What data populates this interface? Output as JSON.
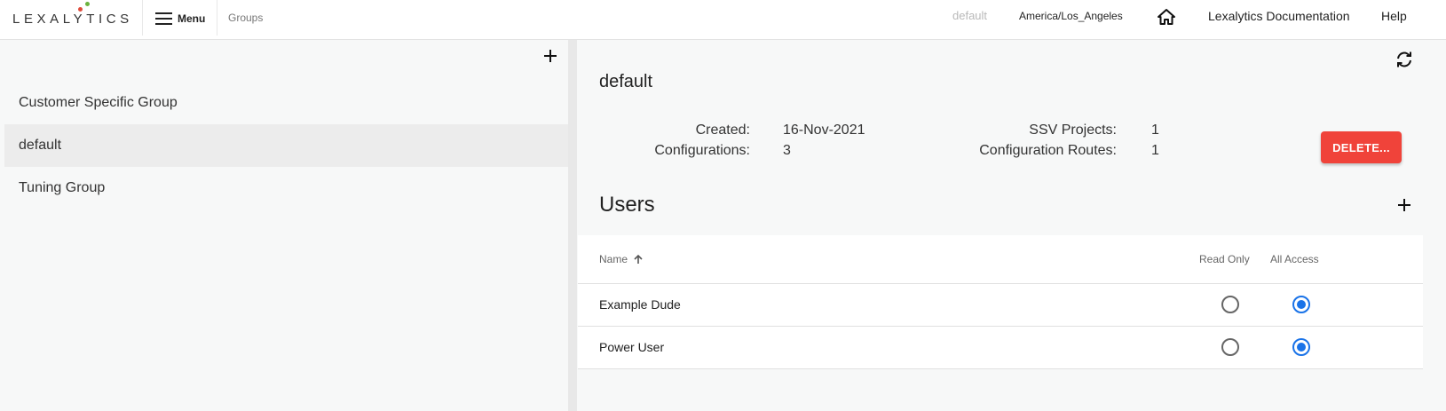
{
  "brand": {
    "logo_text": "LEXALYTICS"
  },
  "topbar": {
    "menu_label": "Menu",
    "breadcrumb": "Groups",
    "current_group": "default",
    "timezone": "America/Los_Angeles",
    "home_icon": "home-icon",
    "docs_link": "Lexalytics Documentation",
    "help_link": "Help"
  },
  "groups": {
    "add_icon": "plus-icon",
    "items": [
      {
        "label": "Customer Specific Group",
        "selected": false
      },
      {
        "label": "default",
        "selected": true
      },
      {
        "label": "Tuning Group",
        "selected": false
      }
    ]
  },
  "detail": {
    "title": "default",
    "refresh_icon": "refresh-icon",
    "stats": {
      "created_label": "Created:",
      "created_value": "16-Nov-2021",
      "configurations_label": "Configurations:",
      "configurations_value": "3",
      "ssv_projects_label": "SSV Projects:",
      "ssv_projects_value": "1",
      "config_routes_label": "Configuration Routes:",
      "config_routes_value": "1"
    },
    "delete_label": "DELETE..."
  },
  "users": {
    "title": "Users",
    "add_icon": "plus-icon",
    "columns": {
      "name": "Name",
      "read_only": "Read Only",
      "all_access": "All Access"
    },
    "sort_icon": "arrow-up-icon",
    "rows": [
      {
        "name": "Example Dude",
        "access": "All Access"
      },
      {
        "name": "Power User",
        "access": "All Access"
      }
    ]
  },
  "colors": {
    "accent": "#1a73e8",
    "danger": "#f0433a",
    "logo_green": "#6cb33f",
    "logo_red": "#e04a3a"
  }
}
